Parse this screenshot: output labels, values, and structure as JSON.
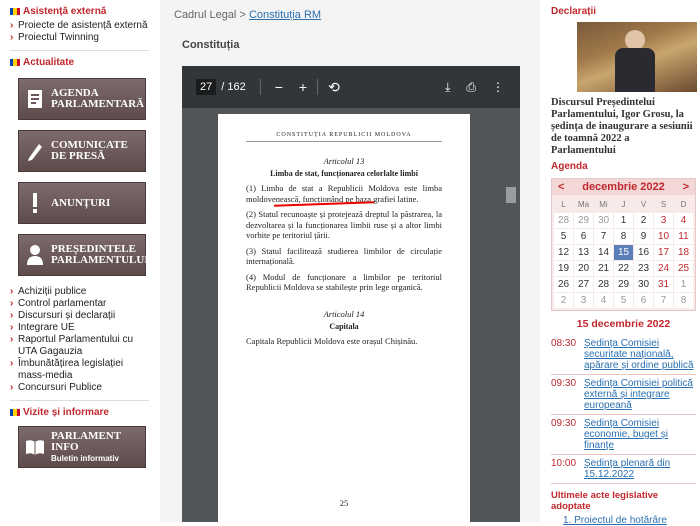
{
  "colors": {
    "accent": "#c0282d",
    "link": "#2a6fb0",
    "button_bg": "#6b5757",
    "viewer_bg": "#525659",
    "toolbar_bg": "#323639"
  },
  "left": {
    "section1_title": "Asistență externă",
    "section1_links": [
      "Proiecte de asistență externă",
      "Proiectul Twinning"
    ],
    "section2_title": "Actualitate",
    "buttons": [
      {
        "line1": "Agenda",
        "line2": "parlamentară",
        "icon": "agenda-icon"
      },
      {
        "line1": "Comunicate",
        "line2": "de presă",
        "icon": "pen-icon"
      },
      {
        "line1": "Anunțuri",
        "line2": "",
        "icon": "exclamation-icon"
      },
      {
        "line1": "Președintele",
        "line2": "Parlamentului",
        "icon": "person-icon"
      }
    ],
    "links": [
      "Achiziții publice",
      "Control parlamentar",
      "Discursuri și declarații",
      "Integrare UE",
      "Raportul Parlamentului cu UTA Gagauzia",
      "Îmbunătățirea legislației mass-media",
      "Concursuri Publice"
    ],
    "section3_title": "Vizite și informare",
    "info_button": {
      "line1": "Parlament",
      "line2": "Info",
      "sub": "Buletin informativ"
    }
  },
  "center": {
    "breadcrumb_root": "Cadrul Legal",
    "breadcrumb_sep": ">",
    "breadcrumb_current": "Constituția RM",
    "page_title": "Constituția",
    "pdf": {
      "current_page": "27",
      "total_pages": "/ 162",
      "header": "CONSTITUȚIA REPUBLICII MOLDOVA",
      "article13_heading": "Articolul 13",
      "article13_title": "Limba de stat, funcționarea celorlalte limbi",
      "paragraphs": [
        "(1) Limba de stat a Republicii Moldova este limba moldovenească, funcționând pe baza grafiei latine.",
        "(2) Statul recunoaște și protejează dreptul la păstrarea, la dezvoltarea și la funcționarea limbii ruse și a altor limbi vorbite pe teritoriul țării.",
        "(3) Statul facilitează studierea limbilor de circulație internațională.",
        "(4) Modul de funcționare a limbilor pe teritoriul Republicii Moldova se stabilește prin lege organică."
      ],
      "article14_heading": "Articolul 14",
      "article14_title": "Capitala",
      "article14_text": "Capitala Republicii Moldova este orașul Chișinău.",
      "page_number": "25"
    }
  },
  "right": {
    "declaratii_title": "Declarații",
    "news_title": "Discursul Președintelui Parlamentului, Igor Grosu, la ședința de inaugurare a sesiunii de toamnă 2022 a Parlamentului",
    "agenda_title": "Agenda",
    "calendar": {
      "prev": "<",
      "next": ">",
      "month": "decembrie 2022",
      "daynames": [
        "L",
        "Ma",
        "Mi",
        "J",
        "V",
        "S",
        "D"
      ],
      "days": [
        "28",
        "29",
        "30",
        "1",
        "2",
        "3",
        "4",
        "5",
        "6",
        "7",
        "8",
        "9",
        "10",
        "11",
        "12",
        "13",
        "14",
        "15",
        "16",
        "17",
        "18",
        "19",
        "20",
        "21",
        "22",
        "23",
        "24",
        "25",
        "26",
        "27",
        "28",
        "29",
        "30",
        "31",
        "1",
        "2",
        "3",
        "4",
        "5",
        "6",
        "7",
        "8"
      ]
    },
    "selected_day": "15 decembrie 2022",
    "events": [
      {
        "time": "08:30",
        "title": "Ședința Comisiei securitate națională, apărare și ordine publică"
      },
      {
        "time": "09:30",
        "title": "Ședința Comisiei politică externă și integrare europeană"
      },
      {
        "time": "09:30",
        "title": "Ședința Comisiei economie, buget și finanțe"
      },
      {
        "time": "10:00",
        "title": "Ședința plenară din 15.12.2022"
      }
    ],
    "latest_title": "Ultimele acte legislative adoptate",
    "latest_item": "1. Proiectul de hotărâre"
  }
}
